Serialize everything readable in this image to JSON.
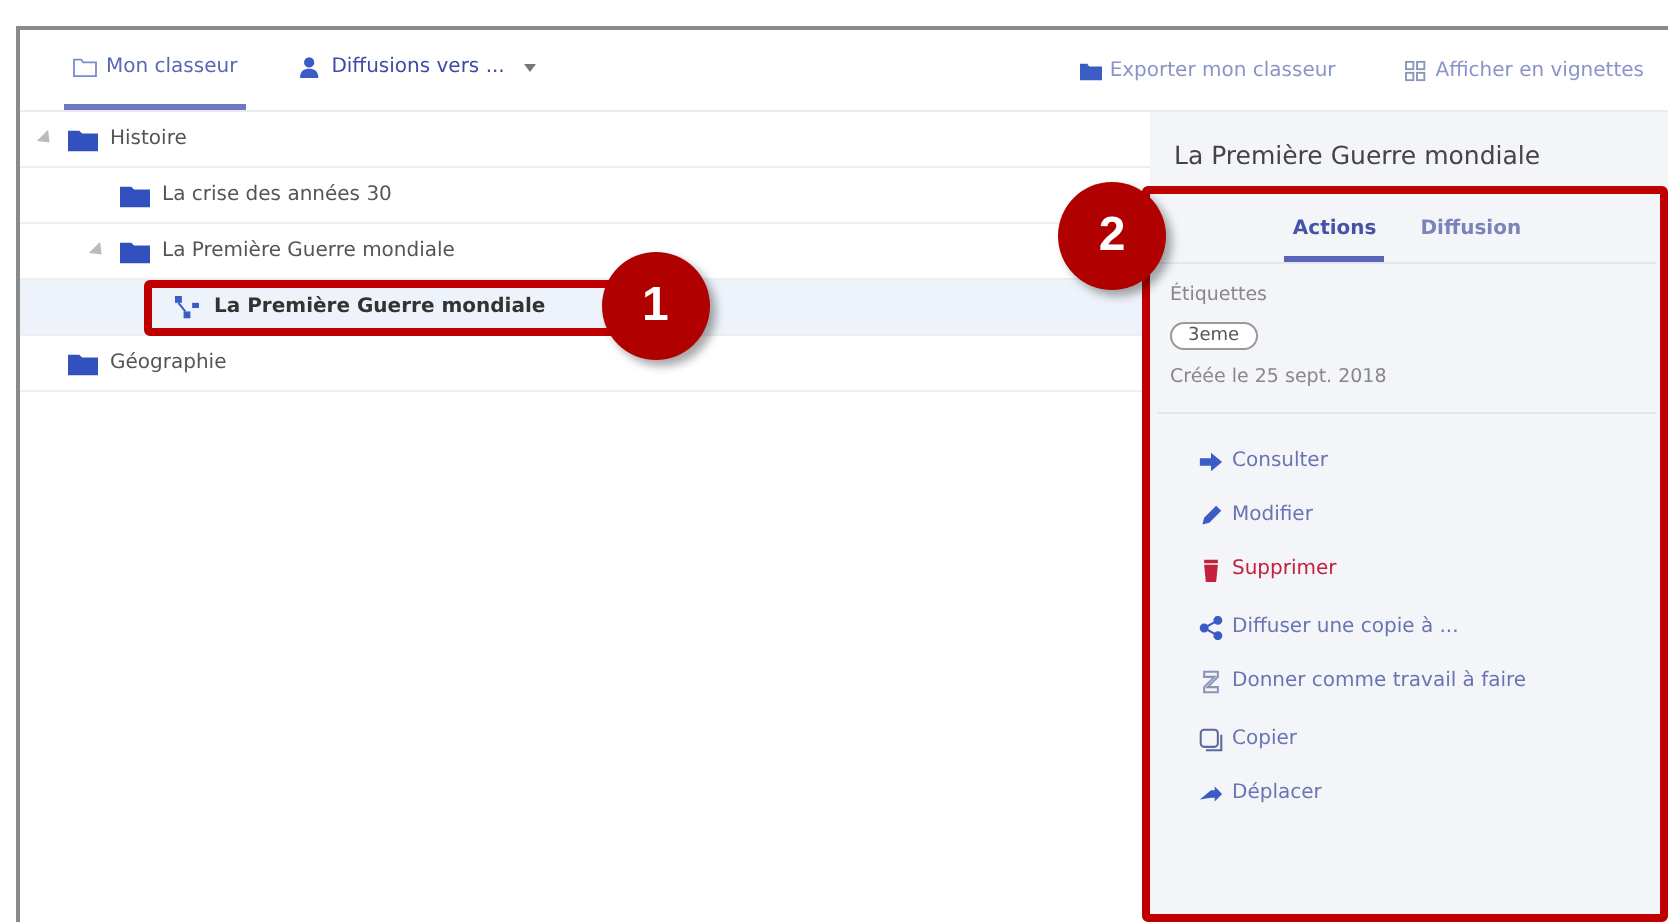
{
  "tabs": [
    {
      "label": "Mon classeur",
      "selected": true
    },
    {
      "label": "Diffusions vers ...",
      "selected": false
    }
  ],
  "toolbar_actions": [
    {
      "label": "Exporter mon classeur"
    },
    {
      "label": "Afficher en vignettes"
    }
  ],
  "tree": [
    {
      "label": "Histoire",
      "kind": "folder",
      "expanded": true,
      "selected": false,
      "children": [
        {
          "label": "La crise des années 30",
          "kind": "folder",
          "selected": false
        },
        {
          "label": "La Première Guerre mondiale",
          "kind": "folder",
          "expanded": true,
          "selected": false,
          "children": [
            {
              "label": "La Première Guerre mondiale",
              "kind": "document",
              "selected": true
            }
          ]
        }
      ]
    },
    {
      "label": "Géographie",
      "kind": "folder",
      "selected": false
    }
  ],
  "panel": {
    "title": "La Première Guerre mondiale",
    "tabs": [
      {
        "label": "Actions",
        "selected": true
      },
      {
        "label": "Diffusion",
        "selected": false
      }
    ],
    "tags_label": "Étiquettes",
    "tags": [
      "3eme"
    ],
    "created": "Créée le 25 sept. 2018",
    "action_groups": [
      [
        {
          "label": "Consulter",
          "danger": false
        },
        {
          "label": "Modifier",
          "danger": false
        },
        {
          "label": "Supprimer",
          "danger": true
        }
      ],
      [
        {
          "label": "Diffuser une copie à ...",
          "danger": false
        },
        {
          "label": "Donner comme travail à faire",
          "danger": false
        }
      ],
      [
        {
          "label": "Copier",
          "danger": false
        },
        {
          "label": "Déplacer",
          "danger": false
        }
      ]
    ]
  },
  "callouts": [
    "1",
    "2"
  ]
}
